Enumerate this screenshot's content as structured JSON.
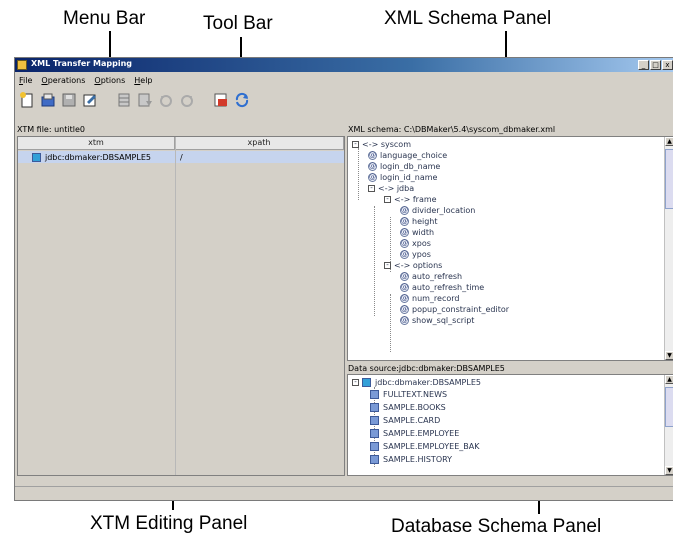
{
  "callouts": {
    "menu_bar": "Menu Bar",
    "tool_bar": "Tool Bar",
    "xml_schema_panel": "XML Schema Panel",
    "xtm_editing_panel": "XTM Editing Panel",
    "database_schema_panel": "Database Schema Panel"
  },
  "window": {
    "title": "XML Transfer Mapping",
    "buttons": [
      "_",
      "□",
      "x"
    ]
  },
  "menu": [
    "File",
    "Operations",
    "Options",
    "Help"
  ],
  "toolbar_icons": [
    "new-file-icon",
    "open-file-icon",
    "save-icon",
    "edit-icon",
    "grid-icon",
    "export-icon",
    "undo-icon",
    "redo-icon",
    "run-icon",
    "refresh-icon"
  ],
  "xtm": {
    "file_label": "XTM file: untitle0",
    "columns": [
      "xtm",
      "xpath"
    ],
    "rows": [
      {
        "xtm": "jdbc:dbmaker:DBSAMPLE5",
        "xpath": "/"
      }
    ]
  },
  "xml_schema": {
    "label": "XML schema: C:\\DBMaker\\5.4\\syscom_dbmaker.xml",
    "nodes": [
      {
        "text": "<-> syscom",
        "kind": "elem"
      },
      {
        "text": "language_choice",
        "kind": "attr"
      },
      {
        "text": "login_db_name",
        "kind": "attr"
      },
      {
        "text": "login_id_name",
        "kind": "attr"
      },
      {
        "text": "<-> jdba",
        "kind": "elem"
      },
      {
        "text": "<-> frame",
        "kind": "elem"
      },
      {
        "text": "divider_location",
        "kind": "attr"
      },
      {
        "text": "height",
        "kind": "attr"
      },
      {
        "text": "width",
        "kind": "attr"
      },
      {
        "text": "xpos",
        "kind": "attr"
      },
      {
        "text": "ypos",
        "kind": "attr"
      },
      {
        "text": "<-> options",
        "kind": "elem"
      },
      {
        "text": "auto_refresh",
        "kind": "attr"
      },
      {
        "text": "auto_refresh_time",
        "kind": "attr"
      },
      {
        "text": "num_record",
        "kind": "attr"
      },
      {
        "text": "popup_constraint_editor",
        "kind": "attr"
      },
      {
        "text": "show_sql_script",
        "kind": "attr"
      }
    ]
  },
  "data_source": {
    "label": "Data source:jdbc:dbmaker:DBSAMPLE5",
    "root": "jdbc:dbmaker:DBSAMPLE5",
    "tables": [
      "FULLTEXT.NEWS",
      "SAMPLE.BOOKS",
      "SAMPLE.CARD",
      "SAMPLE.EMPLOYEE",
      "SAMPLE.EMPLOYEE_BAK",
      "SAMPLE.HISTORY"
    ]
  }
}
